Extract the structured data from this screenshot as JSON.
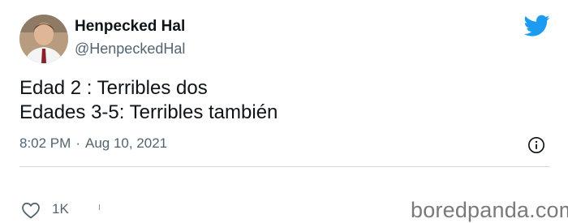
{
  "tweet": {
    "author_name": "Henpecked Hal",
    "author_handle": "@HenpeckedHal",
    "lines": [
      "Edad 2 : Terribles dos",
      "Edades 3-5: Terribles también"
    ],
    "time": "8:02 PM",
    "separator": "·",
    "date": "Aug 10, 2021",
    "like_count": "1K"
  },
  "watermark": "boredpanda.com",
  "icons": {
    "brand": "twitter-bird-icon",
    "info": "info-icon",
    "like": "heart-outline-icon"
  },
  "colors": {
    "twitter_blue": "#1d9bf0",
    "text_primary": "#0f1419",
    "text_secondary": "#536471",
    "divider": "#cfd9de"
  }
}
